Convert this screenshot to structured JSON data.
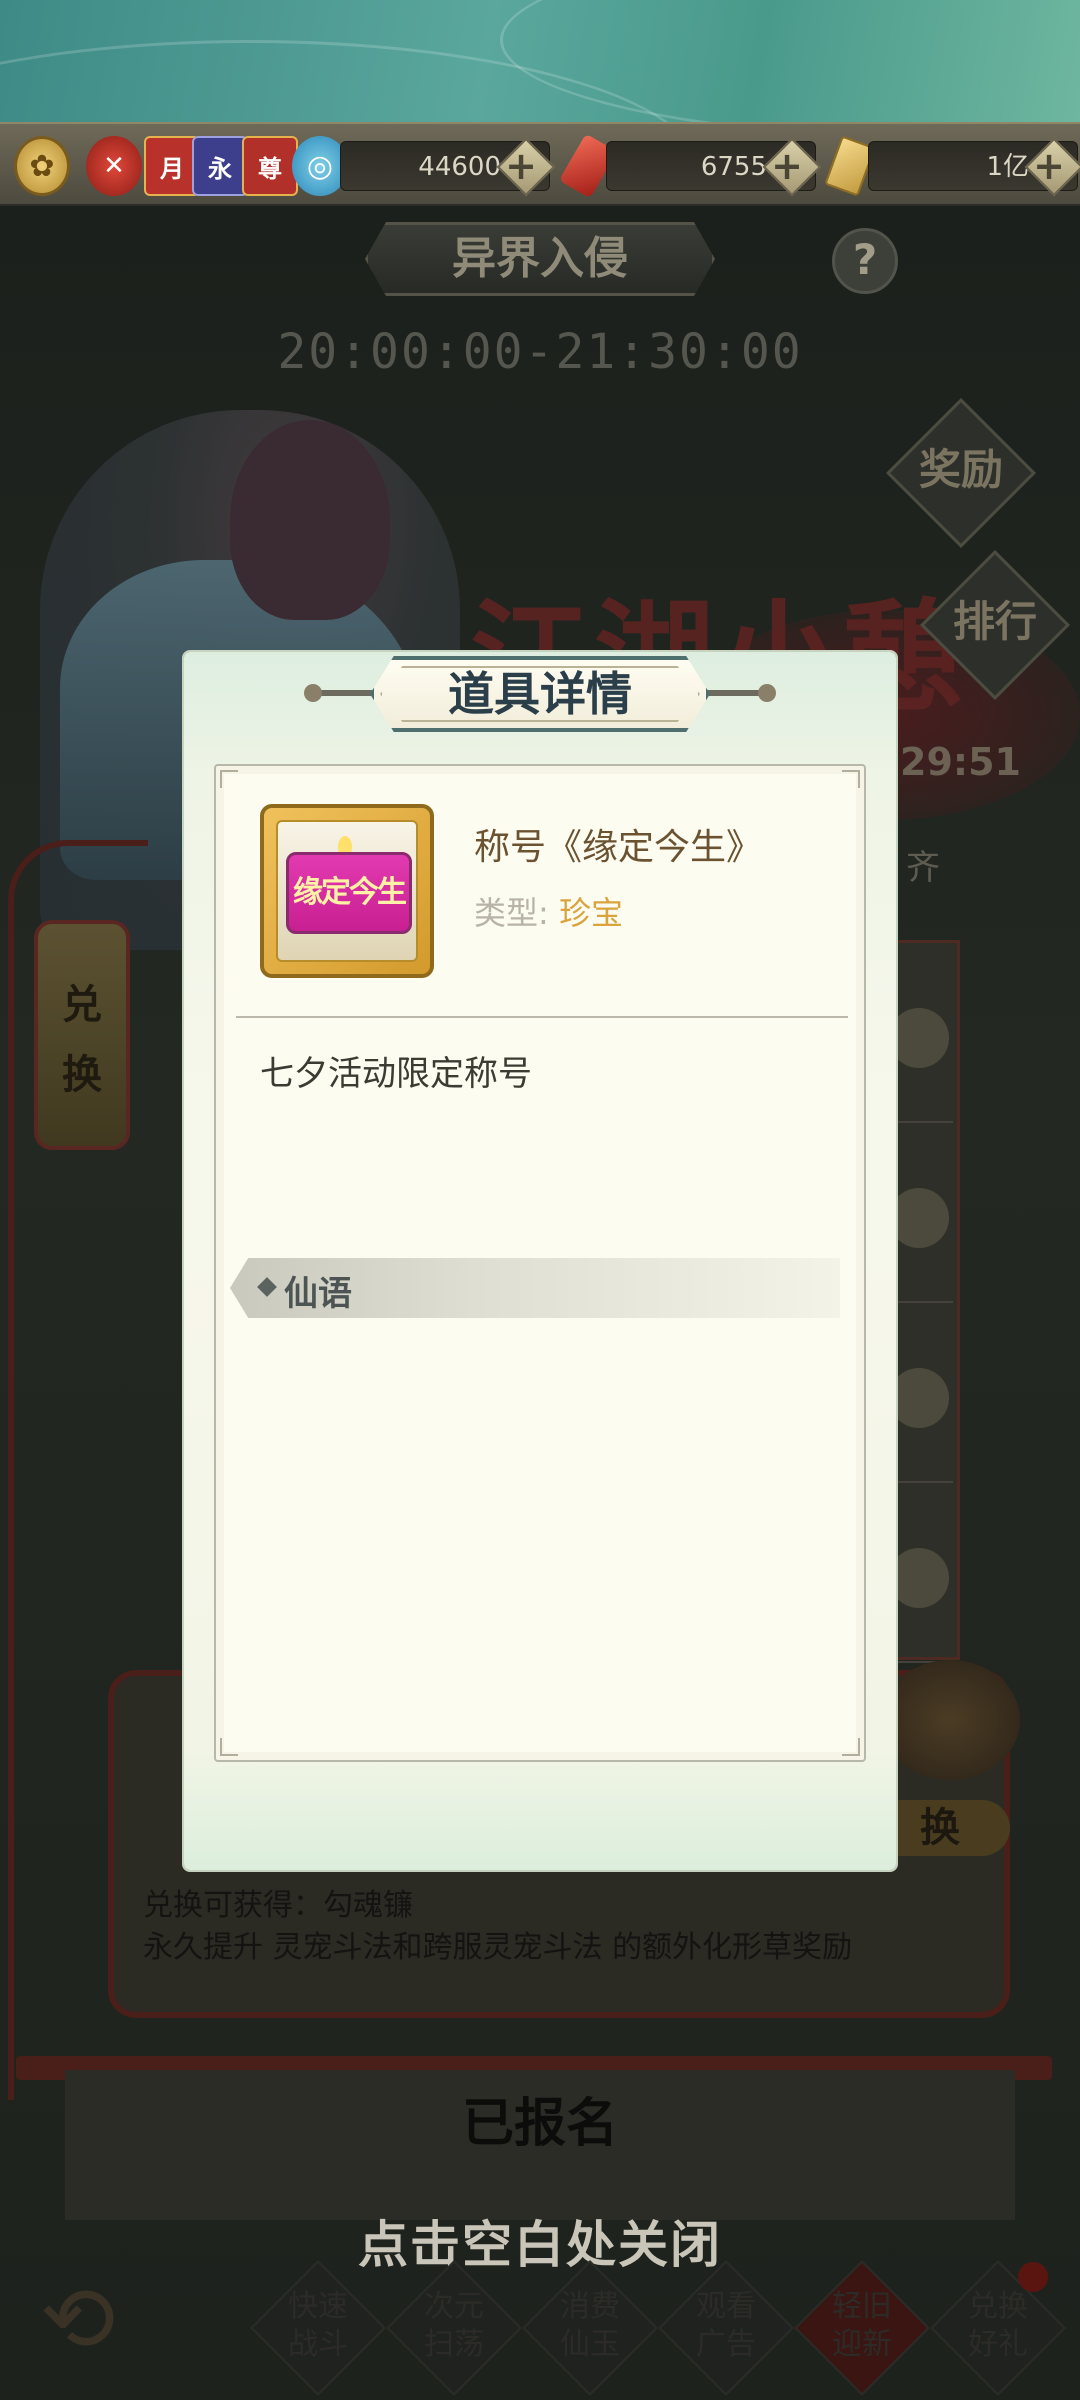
{
  "currency": {
    "jade_value": "44600",
    "red_value": "6755",
    "gold_value": "1亿",
    "badges": [
      "月",
      "永",
      "尊"
    ]
  },
  "event": {
    "title": "异界入侵",
    "time": "20:00:00-21:30:00",
    "banner_text": "江湖小憩",
    "countdown": "29:51",
    "partial_text": "齐",
    "help": "?"
  },
  "side_buttons": {
    "reward": "奖励",
    "rank": "排行"
  },
  "lantern": {
    "label_top": "兑",
    "label_bottom": "换"
  },
  "exchange": {
    "label": "换",
    "gain_line1": "兑换可获得：勾魂镰",
    "gain_line2": "永久提升 灵宠斗法和跨服灵宠斗法 的额外化形草奖励"
  },
  "signup_status": "已报名",
  "close_hint": "点击空白处关闭",
  "bottom_buttons": [
    {
      "line1": "快速",
      "line2": "战斗"
    },
    {
      "line1": "次元",
      "line2": "扫荡"
    },
    {
      "line1": "消费",
      "line2": "仙玉"
    },
    {
      "line1": "观看",
      "line2": "广告"
    },
    {
      "line1": "轻旧",
      "line2": "迎新"
    },
    {
      "line1": "兑换",
      "line2": "好礼"
    }
  ],
  "modal": {
    "title": "道具详情",
    "item": {
      "icon_text": "缘定今生",
      "name": "称号《缘定今生》",
      "type_label": "类型:",
      "type_value": "珍宝",
      "description": "七夕活动限定称号"
    },
    "section_label": "仙语"
  },
  "colors": {
    "modal_bg": "#f7f8ec",
    "type_value": "#d9a33d",
    "item_name": "#6b5332",
    "title_border": "#4f6e6e"
  }
}
